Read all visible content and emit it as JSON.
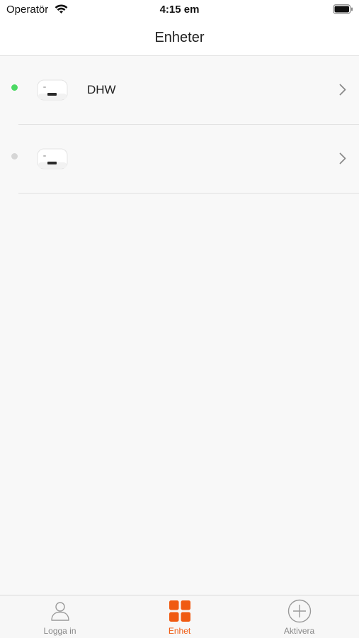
{
  "status_bar": {
    "carrier": "Operatör",
    "time": "4:15 em"
  },
  "nav": {
    "title": "Enheter"
  },
  "devices": [
    {
      "name": "DHW",
      "status": "online",
      "status_color": "#4cd964"
    },
    {
      "name": "",
      "status": "offline",
      "status_color": "#d6d6d6"
    }
  ],
  "tabs": [
    {
      "label": "Logga in",
      "icon": "person-icon",
      "active": false
    },
    {
      "label": "Enhet",
      "icon": "grid-icon",
      "active": true
    },
    {
      "label": "Aktivera",
      "icon": "plus-circle-icon",
      "active": false
    }
  ],
  "colors": {
    "accent": "#f05a12",
    "online": "#4cd964",
    "offline": "#d6d6d6"
  }
}
